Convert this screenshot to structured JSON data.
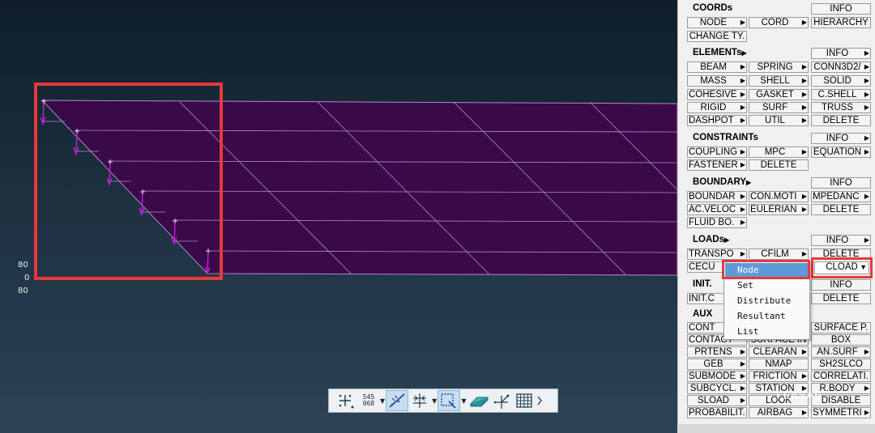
{
  "viewport": {
    "axis_labels": [
      "80",
      "0",
      "80"
    ]
  },
  "panel": {
    "coords": {
      "title": "COORDs",
      "buttons": [
        "INFO",
        "NODE",
        "CORD",
        "HIERARCHY",
        "CHANGE TY."
      ]
    },
    "elements": {
      "title": "ELEMENTs",
      "buttons": [
        "INFO",
        "BEAM",
        "SPRING",
        "CONN3D2/",
        "MASS",
        "SHELL",
        "SOLID",
        "COHESIVE",
        "GASKET",
        "C.SHELL",
        "RIGID",
        "SURF",
        "TRUSS",
        "DASHPOT",
        "UTIL",
        "DELETE"
      ]
    },
    "constraints": {
      "title": "CONSTRAINTs",
      "buttons": [
        "INFO",
        "COUPLING",
        "MPC",
        "EQUATION",
        "FASTENER",
        "DELETE"
      ]
    },
    "boundary": {
      "title": "BOUNDARY",
      "buttons": [
        "INFO",
        "BOUNDAR",
        "CON.MOTI",
        "MPEDANC",
        "AC.VELOC",
        "EULERIAN",
        "DELETE",
        "FLUID BO."
      ]
    },
    "loads": {
      "title": "LOADs",
      "buttons": [
        "INFO",
        "TRANSPO",
        "CFILM",
        "DELETE",
        "CECU",
        "CLOAD"
      ]
    },
    "init": {
      "title": "INIT.",
      "buttons": [
        "INFO",
        "INIT.C",
        "DELETE"
      ]
    },
    "aux": {
      "title": "AUX",
      "buttons": [
        "CONT",
        "SURFACE P.",
        "CONTACT",
        "SURFACE IN",
        "BOX",
        "PRTENS",
        "CLEARAN",
        "AN.SURF",
        "GEB",
        "NMAP",
        "SH2SLCO",
        "SUBMODE",
        "FRICTION",
        "CORRELATI.",
        "SUBCYCL.",
        "STATION",
        "R.BODY",
        "SLOAD",
        "LOOK",
        "DISABLE",
        "PROBABILIT.",
        "AIRBAG",
        "SYMMETRI"
      ]
    }
  },
  "dropdown": {
    "items": [
      "Node",
      "Set",
      "Distribute",
      "Resultant",
      "List"
    ],
    "active": "Node"
  },
  "toolbar": {
    "node_id_label": "545\n068"
  },
  "watermark": "FEASAB",
  "colors": {
    "mesh_fill": "#3a0a48",
    "mesh_lines": "#b08ac8",
    "highlight": "#e83a3a",
    "dropdown_active": "#5b9bd8",
    "load_marker": "#c51fd6"
  }
}
